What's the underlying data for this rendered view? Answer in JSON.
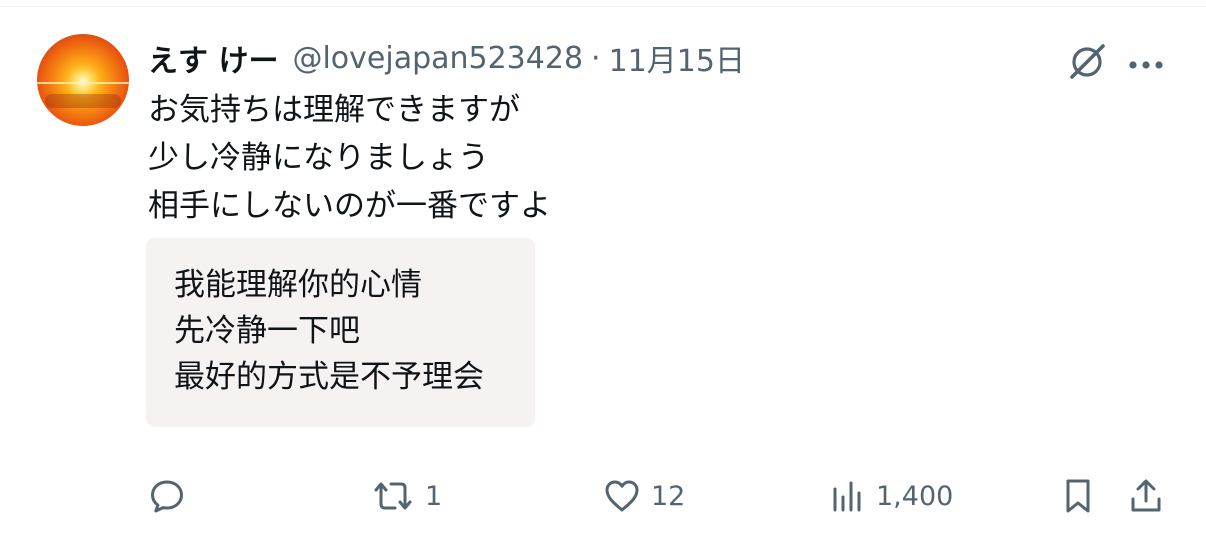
{
  "post": {
    "display_name": "えす けー",
    "handle": "@lovejapan523428",
    "separator": "·",
    "time": "11月15日",
    "text_lines": [
      "お気持ちは理解できますが",
      "少し冷静になりましょう",
      "相手にしないのが一番ですよ"
    ],
    "translation_lines": [
      "我能理解你的心情",
      "先冷静一下吧",
      "最好的方式是不予理会"
    ]
  },
  "actions": {
    "replies": "",
    "reposts": "1",
    "likes": "12",
    "views": "1,400"
  },
  "icons": {
    "avatar": "sunset-avatar",
    "grok": "grok-icon",
    "more": "more-icon",
    "reply": "reply-icon",
    "repost": "repost-icon",
    "like": "heart-icon",
    "views": "views-icon",
    "bookmark": "bookmark-icon",
    "share": "share-icon"
  },
  "colors": {
    "text": "#0f1419",
    "secondary": "#536471",
    "translation_bg": "#f7f2f2"
  }
}
